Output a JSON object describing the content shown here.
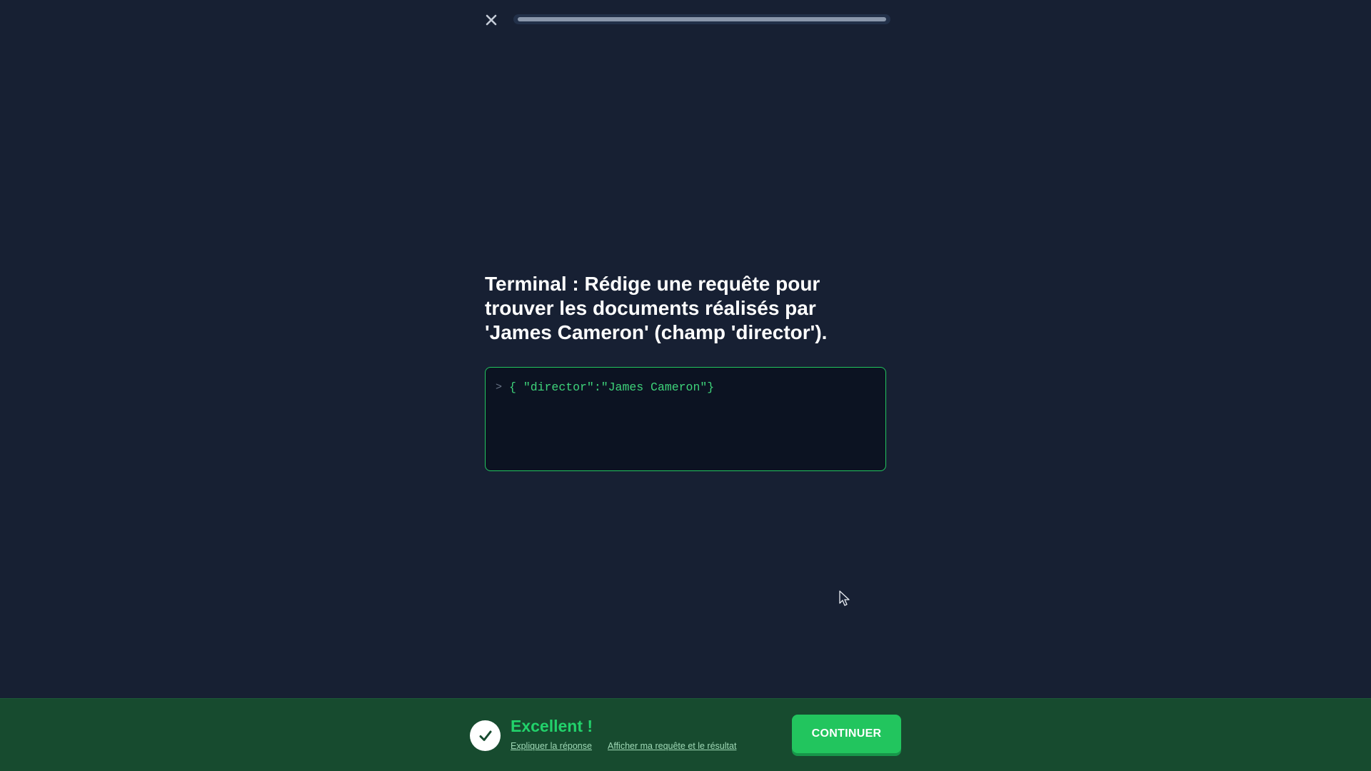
{
  "header": {
    "close_icon": "close-icon",
    "progress_value": 1.0,
    "progress_color": "#8a97ab"
  },
  "question": {
    "text": "Terminal : Rédige une requête pour trouver les documents réalisés par 'James Cameron' (champ 'director')."
  },
  "terminal": {
    "prompt": ">",
    "code": "{ \"director\":\"James Cameron\"}",
    "border_color": "#22c55e",
    "code_color": "#3ed37a"
  },
  "feedback": {
    "icon": "check-icon",
    "title": "Excellent !",
    "explain_link": "Expliquer la réponse",
    "show_link": "Afficher ma requête et le résultat",
    "continue_label": "CONTINUER",
    "background_color": "#174b2f",
    "accent_color": "#22c55e"
  }
}
